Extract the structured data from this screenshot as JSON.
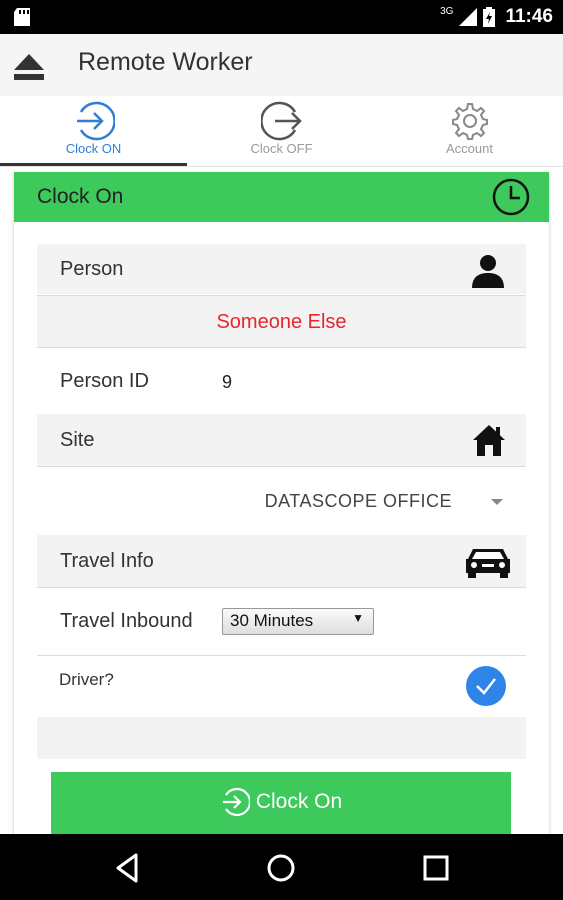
{
  "status_bar": {
    "network": "3G",
    "time": "11:46"
  },
  "app_bar": {
    "title": "Remote Worker"
  },
  "tabs": [
    {
      "label": "Clock ON",
      "icon": "clock-on-icon",
      "active": true
    },
    {
      "label": "Clock OFF",
      "icon": "clock-off-icon",
      "active": false
    },
    {
      "label": "Account",
      "icon": "gear-icon",
      "active": false
    }
  ],
  "card": {
    "header": {
      "title": "Clock On",
      "icon": "clock-icon"
    },
    "person": {
      "label": "Person",
      "icon": "person-icon",
      "selected": "Someone Else"
    },
    "person_id": {
      "label": "Person ID",
      "value": "9"
    },
    "site": {
      "label": "Site",
      "icon": "home-icon",
      "selected": "DATASCOPE OFFICE"
    },
    "travel_info": {
      "label": "Travel Info",
      "icon": "car-icon"
    },
    "travel_inbound": {
      "label": "Travel Inbound",
      "selected": "30 Minutes"
    },
    "driver": {
      "label": "Driver?",
      "checked": true
    },
    "submit": {
      "label": "Clock On"
    }
  },
  "colors": {
    "accent_green": "#3ec95c",
    "active_blue": "#2e7ed8",
    "alert_red": "#e8262a",
    "check_blue": "#2f84e8"
  }
}
